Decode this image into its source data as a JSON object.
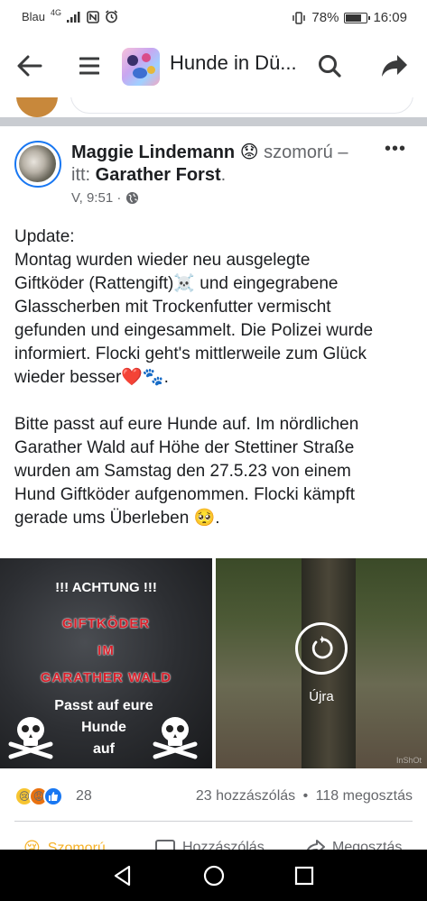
{
  "status_bar": {
    "carrier": "Blau",
    "network": "4G",
    "battery_percent_label": "78%",
    "battery_level": 0.78,
    "time": "16:09"
  },
  "header": {
    "back_icon": "arrow-left-icon",
    "menu_icon": "hamburger-icon",
    "group_title": "Hunde in Dü...",
    "search_icon": "search-icon",
    "share_icon": "share-arrow-icon"
  },
  "post": {
    "author": "Maggie Lindemann",
    "feeling_emoji": "😟",
    "feeling": " szomorú –",
    "location_prefix": "itt: ",
    "location": "Garather Forst",
    "location_suffix": ".",
    "time": "V, 9:51 ·",
    "privacy_icon": "globe-icon",
    "more_label": "•••",
    "text_block_1": [
      "Update:",
      "Montag wurden wieder neu ausgelegte",
      "Giftköder (Rattengift)☠️ und eingegrabene",
      "Glasscherben mit Trockenfutter vermischt",
      "gefunden und eingesammelt. Die Polizei wurde",
      "informiert. Flocki geht's mittlerweile zum Glück",
      "wieder besser❤️🐾."
    ],
    "text_block_2": [
      "Bitte passt auf eure Hunde auf. Im nördlichen",
      "Garather Wald auf Höhe der Stettiner Straße",
      "wurden am Samstag den 27.5.23 von einem",
      "Hund Giftköder aufgenommen. Flocki kämpft",
      "gerade ums Überleben 🥺."
    ]
  },
  "image_left": {
    "line1": "!!! ACHTUNG !!!",
    "line2": "GIFTKÖDER",
    "line3": "IM",
    "line4": "GARATHER WALD",
    "line5": "Passt auf eure",
    "line6": "Hunde",
    "line7": "auf"
  },
  "image_right": {
    "replay_icon": "replay-icon",
    "replay_label": "Újra",
    "watermark": "InShOt"
  },
  "reactions": {
    "icons": [
      "sad-reaction-icon",
      "angry-reaction-icon",
      "like-reaction-icon"
    ],
    "count": "28",
    "comments": "23 hozzászólás",
    "separator": "•",
    "shares": "118 megosztás"
  },
  "actions": {
    "react_label": "Szomorú",
    "comment_label": "Hozzászólás",
    "share_label": "Megosztás"
  },
  "colors": {
    "facebook_blue": "#1877f2",
    "reaction_yellow": "#f7b125",
    "alert_red": "#d8202b"
  }
}
